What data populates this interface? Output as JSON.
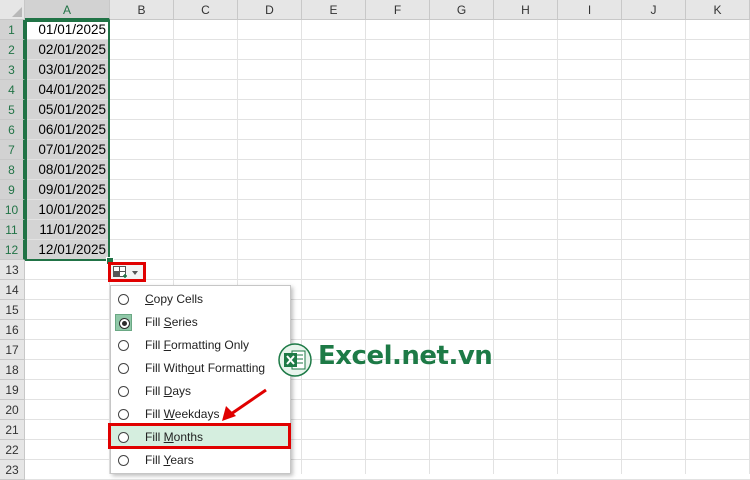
{
  "columns": [
    "A",
    "B",
    "C",
    "D",
    "E",
    "F",
    "G",
    "H",
    "I",
    "J",
    "K"
  ],
  "rows": [
    "1",
    "2",
    "3",
    "4",
    "5",
    "6",
    "7",
    "8",
    "9",
    "10",
    "11",
    "12",
    "13",
    "14",
    "15",
    "16",
    "17",
    "18",
    "19",
    "20",
    "21",
    "22",
    "23"
  ],
  "cells": [
    "01/01/2025",
    "02/01/2025",
    "03/01/2025",
    "04/01/2025",
    "05/01/2025",
    "06/01/2025",
    "07/01/2025",
    "08/01/2025",
    "09/01/2025",
    "10/01/2025",
    "11/01/2025",
    "12/01/2025"
  ],
  "autofill_menu": {
    "items": [
      {
        "pre": "",
        "u": "C",
        "post": "opy Cells"
      },
      {
        "pre": "Fill ",
        "u": "S",
        "post": "eries"
      },
      {
        "pre": "Fill ",
        "u": "F",
        "post": "ormatting Only"
      },
      {
        "pre": "Fill With",
        "u": "o",
        "post": "ut Formatting"
      },
      {
        "pre": "Fill ",
        "u": "D",
        "post": "ays"
      },
      {
        "pre": "Fill ",
        "u": "W",
        "post": "eekdays"
      },
      {
        "pre": "Fill ",
        "u": "M",
        "post": "onths"
      },
      {
        "pre": "Fill ",
        "u": "Y",
        "post": "ears"
      }
    ],
    "checked_index": 1,
    "highlighted_index": 6
  },
  "watermark": {
    "text": "Excel.net.vn",
    "icon": "excel-logo-icon"
  },
  "colors": {
    "excel_green": "#217346",
    "highlight_red": "#e00000"
  }
}
